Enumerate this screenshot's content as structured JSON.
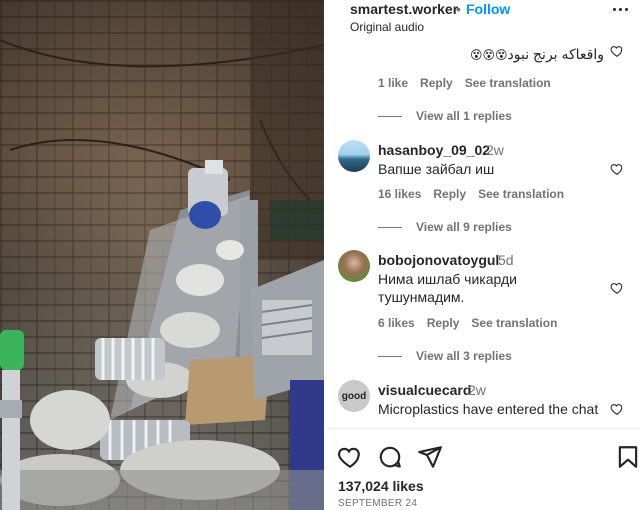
{
  "post": {
    "username": "smartest.worker",
    "separator": "•",
    "follow_label": "Follow",
    "audio": "Original audio",
    "likes": "137,024 likes",
    "date": "SEPTEMBER 24"
  },
  "comments": [
    {
      "text": "واقعاکه برنج نبود",
      "emojis": "😵😵😵",
      "likes": "1 like",
      "reply": "Reply",
      "translate": "See translation",
      "view_replies": "View all 1 replies"
    },
    {
      "username": "hasanboy_09_02",
      "time": "2w",
      "text": "Вапше зайбал иш",
      "likes": "16 likes",
      "reply": "Reply",
      "translate": "See translation",
      "view_replies": "View all 9 replies"
    },
    {
      "username": "bobojonovatoygul",
      "time": "5d",
      "text_line1": "Нима ишлаб чикарди",
      "text_line2": "тушунмадим.",
      "likes": "6 likes",
      "reply": "Reply",
      "translate": "See translation",
      "view_replies": "View all 3 replies"
    },
    {
      "username": "visualcuecard",
      "time": "2w",
      "text": "Microplastics have entered the chat",
      "avatar_text": "good"
    }
  ],
  "icons": {
    "more": "more-options-icon",
    "heart": "heart-icon",
    "comment": "comment-icon",
    "share": "share-icon",
    "save": "bookmark-icon"
  },
  "colors": {
    "accent": "#0095f6",
    "text": "#262626",
    "secondary": "#737373"
  }
}
